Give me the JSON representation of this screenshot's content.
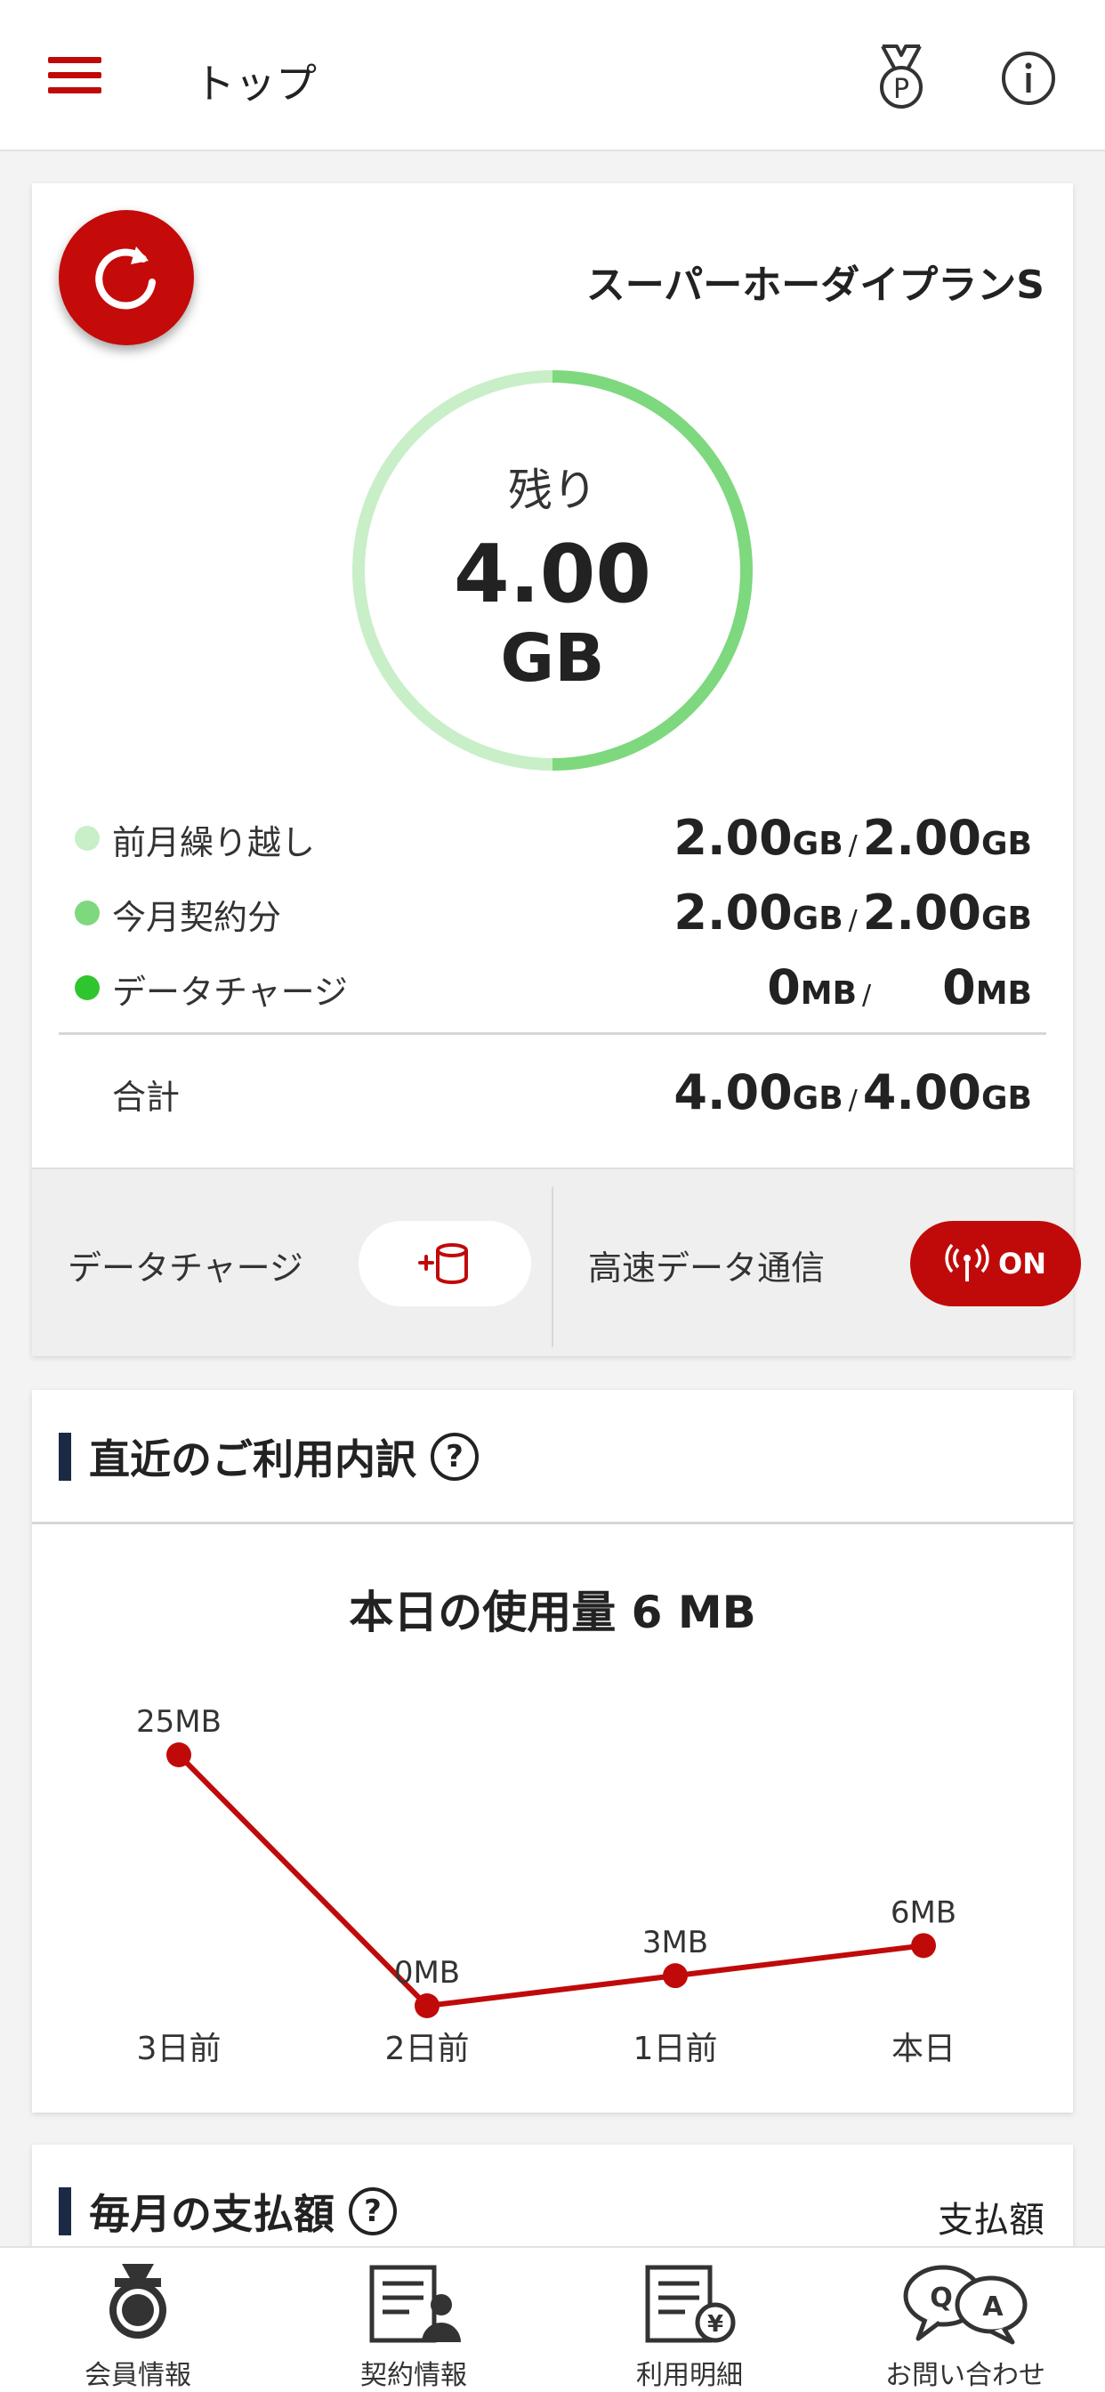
{
  "header": {
    "title": "トップ",
    "menu_icon": "hamburger-icon",
    "points_icon": "medal-points-icon",
    "info_icon": "info-icon",
    "accent_color": "#c00a0a"
  },
  "plan": {
    "name": "スーパーホーダイプランS",
    "refresh_icon": "refresh-icon",
    "remaining_label": "残り",
    "remaining_value": "4.00",
    "remaining_unit": "GB",
    "remaining_fraction": 1.0,
    "rows": [
      {
        "label": "前月繰り越し",
        "color": "#c8efc8",
        "used": "2.00",
        "used_unit": "GB",
        "total": "2.00",
        "total_unit": "GB"
      },
      {
        "label": "今月契約分",
        "color": "#7ed87e",
        "used": "2.00",
        "used_unit": "GB",
        "total": "2.00",
        "total_unit": "GB"
      },
      {
        "label": "データチャージ",
        "color": "#2fc52f",
        "used": "0",
        "used_unit": "MB",
        "total": "0",
        "total_unit": "MB"
      }
    ],
    "total_label": "合計",
    "total_used": "4.00",
    "total_used_unit": "GB",
    "total_total": "4.00",
    "total_total_unit": "GB",
    "slash": "/"
  },
  "charge": {
    "data_charge_label": "データチャージ",
    "data_charge_icon": "add-database-icon",
    "high_speed_label": "高速データ通信",
    "high_speed_icon": "antenna-signal-icon",
    "high_speed_state": "ON"
  },
  "usage": {
    "section_title": "直近のご利用内訳",
    "help_icon": "?",
    "chart_title": "本日の使用量 6 MB"
  },
  "chart_data": {
    "type": "line",
    "categories": [
      "3日前",
      "2日前",
      "1日前",
      "本日"
    ],
    "values": [
      25,
      0,
      3,
      6
    ],
    "data_labels": [
      "25MB",
      "0MB",
      "3MB",
      "6MB"
    ],
    "title": "本日の使用量 6 MB",
    "xlabel": "",
    "ylabel": "",
    "ylim": [
      0,
      25
    ],
    "grid": false,
    "color": "#c00a0a"
  },
  "payment": {
    "section_title": "毎月の支払額",
    "help_icon": "?",
    "right_label": "支払額"
  },
  "tabs": [
    {
      "label": "会員情報",
      "icon": "member-badge-icon"
    },
    {
      "label": "契約情報",
      "icon": "contract-document-icon"
    },
    {
      "label": "利用明細",
      "icon": "billing-statement-icon"
    },
    {
      "label": "お問い合わせ",
      "icon": "qa-chat-icon"
    }
  ]
}
